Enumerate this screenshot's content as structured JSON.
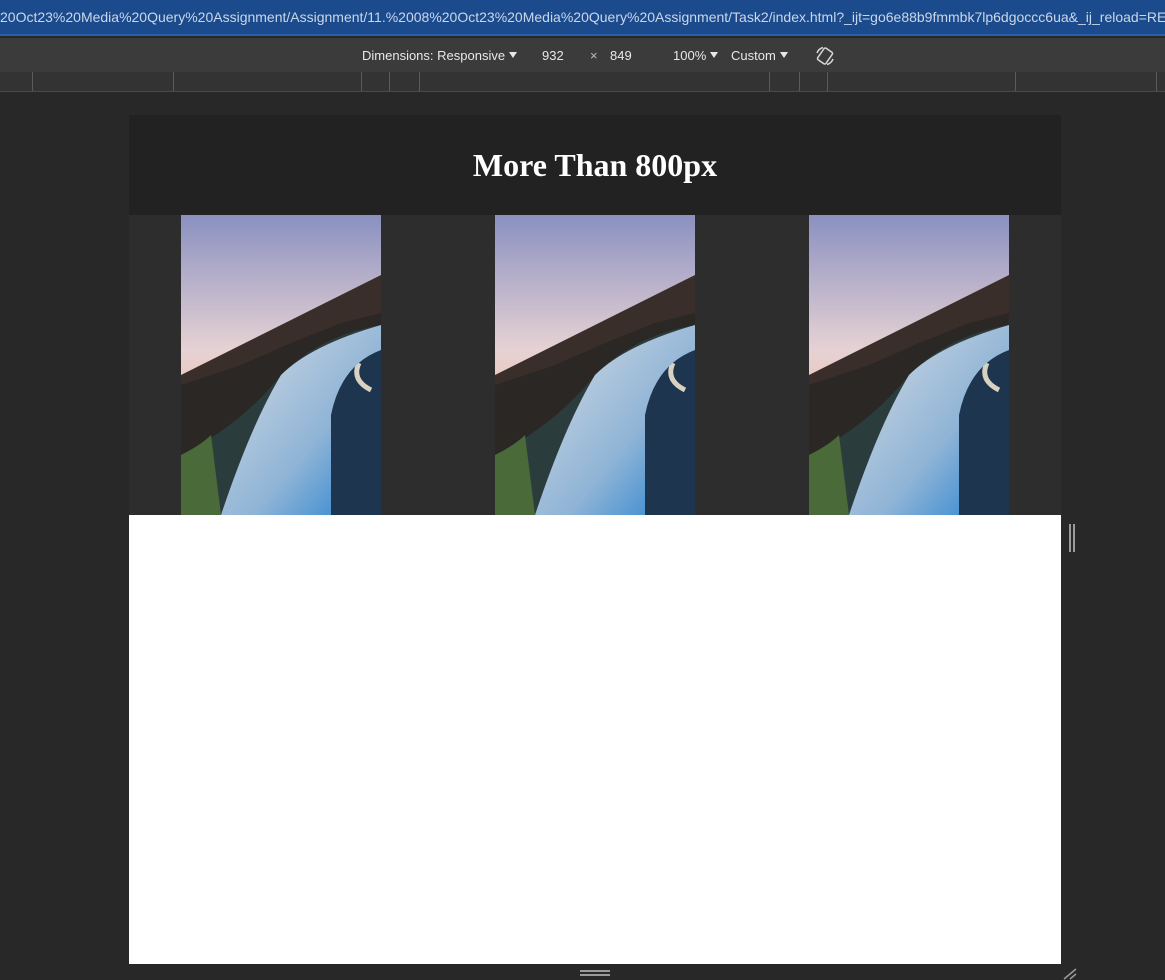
{
  "browser": {
    "url": "20Oct23%20Media%20Query%20Assignment/Assignment/11.%2008%20Oct23%20Media%20Query%20Assignment/Task2/index.html?_ijt=go6e88b9fmmbk7lp6dgoccc6ua&_ij_reload=RE..."
  },
  "device_toolbar": {
    "dimensions_label": "Dimensions: Responsive",
    "width": "932",
    "times": "×",
    "height": "849",
    "zoom": "100%",
    "throttle": "Custom",
    "rotate_icon": "rotate-icon"
  },
  "page": {
    "title": "More Than 800px",
    "images": [
      {
        "alt": "coastal road photo"
      },
      {
        "alt": "coastal road photo"
      },
      {
        "alt": "coastal road photo"
      }
    ]
  },
  "colors": {
    "address_bar": "#1b4b8c",
    "toolbar": "#3b3b3b",
    "page_header": "#222222",
    "gallery_bg": "#2d2d2d"
  }
}
